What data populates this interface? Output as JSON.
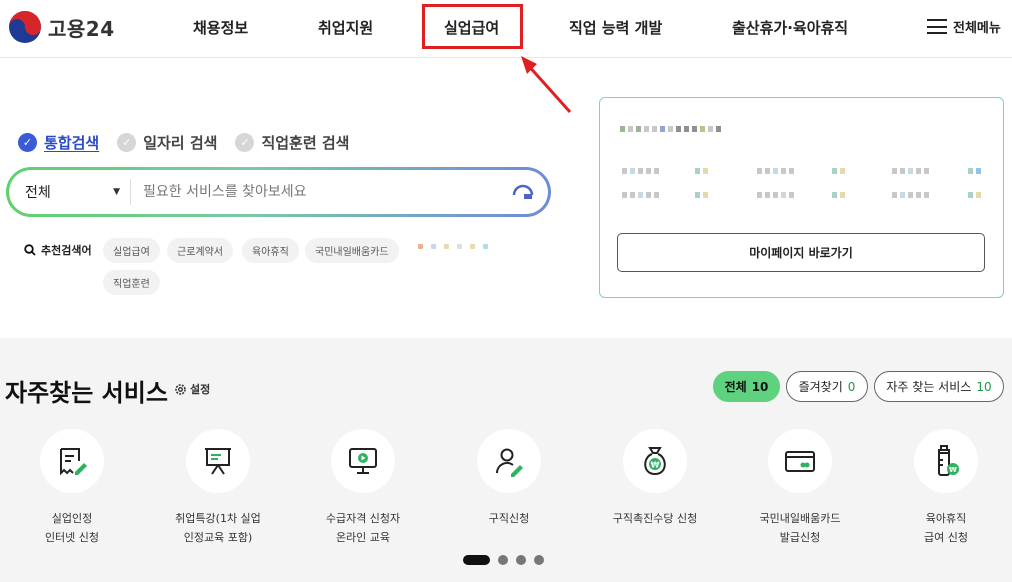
{
  "header": {
    "logo_text": "고용24",
    "nav": [
      "채용정보",
      "취업지원",
      "실업급여",
      "직업 능력 개발",
      "출산휴가·육아휴직"
    ],
    "menu_all": "전체메뉴"
  },
  "search": {
    "tabs": [
      "통합검색",
      "일자리 검색",
      "직업훈련 검색"
    ],
    "active_tab": "통합검색",
    "scope": "전체",
    "placeholder": "필요한 서비스를 찾아보세요",
    "keyword_label": "추천검색어",
    "keywords": [
      "실업급여",
      "근로계약서",
      "육아휴직",
      "국민내일배움카드",
      "직업훈련"
    ]
  },
  "panel": {
    "mypage_button": "마이페이지 바로가기"
  },
  "services_section": {
    "title": "자주찾는 서비스",
    "setting": "설정",
    "filters": [
      {
        "label": "전체",
        "count": "10"
      },
      {
        "label": "즐겨찾기",
        "count": "0"
      },
      {
        "label": "자주 찾는 서비스",
        "count": "10"
      }
    ],
    "items": [
      {
        "label": "실업인정\n인터넷 신청",
        "icon": "document-pen-icon"
      },
      {
        "label": "취업특강(1차 실업\n인정교육 포함)",
        "icon": "presentation-board-icon"
      },
      {
        "label": "수급자격 신청자\n온라인 교육",
        "icon": "monitor-play-icon"
      },
      {
        "label": "구직신청",
        "icon": "person-pen-icon"
      },
      {
        "label": "구직촉진수당 신청",
        "icon": "money-bag-icon"
      },
      {
        "label": "국민내일배움카드\n발급신청",
        "icon": "card-icon"
      },
      {
        "label": "육아휴직\n급여 신청",
        "icon": "baby-bottle-icon"
      }
    ],
    "pagination": 4
  },
  "colors": {
    "accent_green": "#5ed27e",
    "accent_blue": "#3b5bd6",
    "highlight_red": "#e02020"
  }
}
